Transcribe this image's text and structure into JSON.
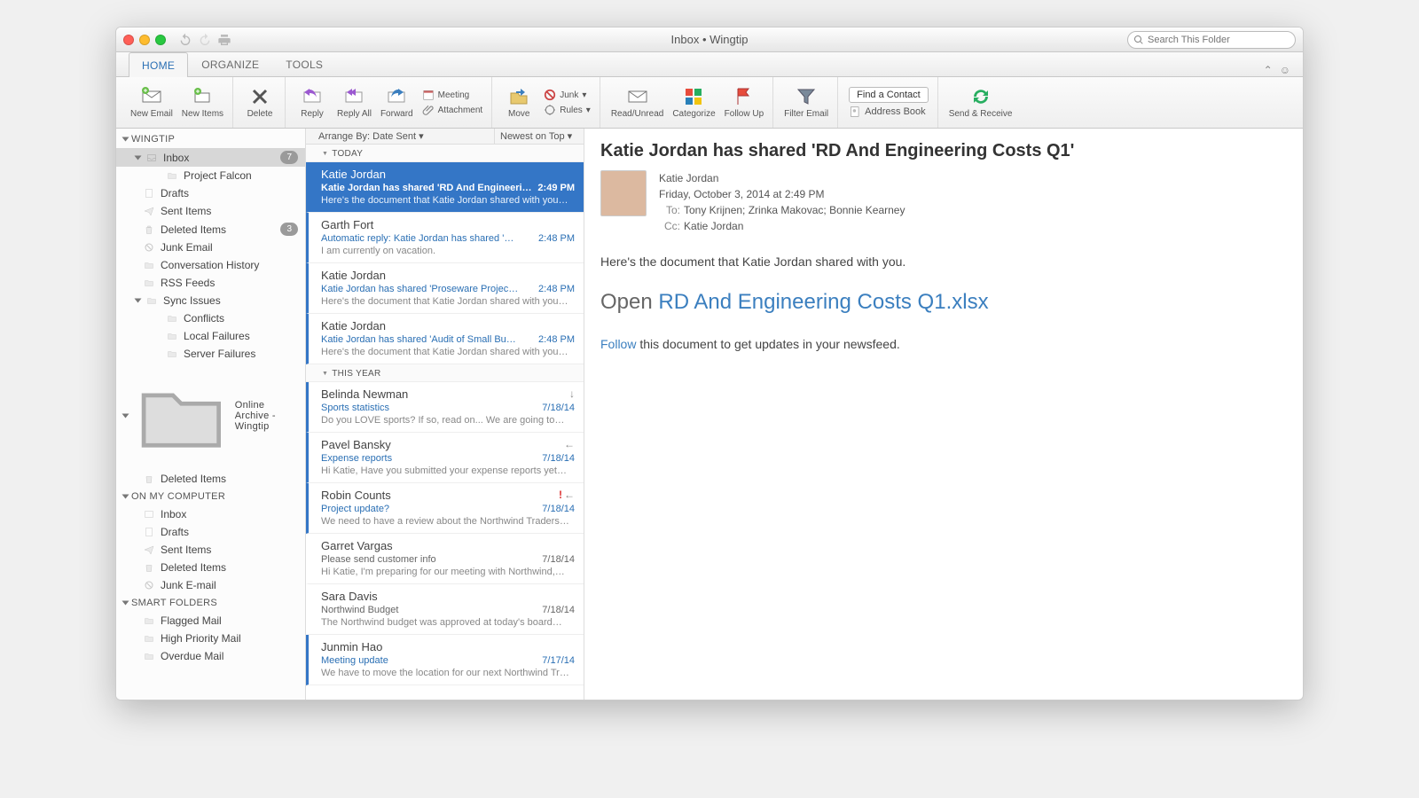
{
  "title": "Inbox • Wingtip",
  "search_placeholder": "Search This Folder",
  "tabs": [
    "HOME",
    "ORGANIZE",
    "TOOLS"
  ],
  "ribbon": {
    "new_email": "New\nEmail",
    "new_items": "New\nItems",
    "delete": "Delete",
    "reply": "Reply",
    "reply_all": "Reply\nAll",
    "forward": "Forward",
    "meeting": "Meeting",
    "attachment": "Attachment",
    "move": "Move",
    "junk": "Junk",
    "rules": "Rules",
    "read_unread": "Read/Unread",
    "categorize": "Categorize",
    "follow_up": "Follow\nUp",
    "filter_email": "Filter\nEmail",
    "find_contact": "Find a Contact",
    "address_book": "Address Book",
    "send_receive": "Send &\nReceive"
  },
  "sidebar": {
    "account": "WINGTIP",
    "inbox": "Inbox",
    "inbox_badge": "7",
    "project_falcon": "Project Falcon",
    "drafts": "Drafts",
    "sent": "Sent Items",
    "deleted": "Deleted Items",
    "deleted_badge": "3",
    "junk": "Junk Email",
    "conv": "Conversation History",
    "rss": "RSS Feeds",
    "sync": "Sync Issues",
    "conflicts": "Conflicts",
    "local_failures": "Local Failures",
    "server_failures": "Server Failures",
    "archive": "Online Archive - Wingtip",
    "archive_deleted": "Deleted Items",
    "on_computer": "ON MY COMPUTER",
    "c_inbox": "Inbox",
    "c_drafts": "Drafts",
    "c_sent": "Sent Items",
    "c_deleted": "Deleted Items",
    "c_junk": "Junk E-mail",
    "smart": "SMART FOLDERS",
    "flagged": "Flagged Mail",
    "high": "High Priority Mail",
    "overdue": "Overdue Mail"
  },
  "arrange": {
    "left": "Arrange By: Date Sent  ▾",
    "right": "Newest on Top  ▾"
  },
  "groups": {
    "today": "TODAY",
    "year": "THIS YEAR"
  },
  "messages_today": [
    {
      "from": "Katie Jordan",
      "subject": "Katie Jordan has shared 'RD And Engineeri…",
      "time": "2:49 PM",
      "preview": "Here's the document that Katie Jordan shared with you…",
      "selected": true,
      "unread": true
    },
    {
      "from": "Garth Fort",
      "subject": "Automatic reply: Katie Jordan has shared '…",
      "time": "2:48 PM",
      "preview": "I am currently on vacation.",
      "unread": true
    },
    {
      "from": "Katie Jordan",
      "subject": "Katie Jordan has shared 'Proseware Projec…",
      "time": "2:48 PM",
      "preview": "Here's the document that Katie Jordan shared with you…",
      "unread": true
    },
    {
      "from": "Katie Jordan",
      "subject": "Katie Jordan has shared 'Audit of Small Bu…",
      "time": "2:48 PM",
      "preview": "Here's the document that Katie Jordan shared with you…",
      "unread": true
    }
  ],
  "messages_year": [
    {
      "from": "Belinda Newman",
      "subject": "Sports statistics",
      "time": "7/18/14",
      "preview": "Do you LOVE sports? If so, read on... We are going to…",
      "unread": true,
      "flags": [
        "download"
      ]
    },
    {
      "from": "Pavel Bansky",
      "subject": "Expense reports",
      "time": "7/18/14",
      "preview": "Hi Katie, Have you submitted your expense reports yet…",
      "unread": true,
      "flags": [
        "reply"
      ]
    },
    {
      "from": "Robin Counts",
      "subject": "Project update?",
      "time": "7/18/14",
      "preview": "We need to have a review about the Northwind Traders…",
      "unread": true,
      "flags": [
        "important",
        "reply"
      ]
    },
    {
      "from": "Garret Vargas",
      "subject": "Please send customer info",
      "time": "7/18/14",
      "preview": "Hi Katie, I'm preparing for our meeting with Northwind,…",
      "gray": true
    },
    {
      "from": "Sara Davis",
      "subject": "Northwind Budget",
      "time": "7/18/14",
      "preview": "The Northwind budget was approved at today's board…",
      "gray": true
    },
    {
      "from": "Junmin Hao",
      "subject": "Meeting update",
      "time": "7/17/14",
      "preview": "We have to move the location for our next Northwind Tr…",
      "unread": true
    }
  ],
  "reader": {
    "title": "Katie Jordan has shared 'RD And Engineering Costs Q1'",
    "from": "Katie Jordan",
    "date": "Friday, October 3, 2014 at 2:49 PM",
    "to_label": "To:",
    "to": "Tony Krijnen;   Zrinka Makovac;   Bonnie Kearney",
    "cc_label": "Cc:",
    "cc": "Katie Jordan",
    "body1": "Here's the document that Katie Jordan shared with you.",
    "open_prefix": "Open ",
    "open_link": "RD And Engineering Costs Q1.xlsx",
    "follow_link": "Follow",
    "follow_rest": " this document to get updates in your newsfeed."
  }
}
